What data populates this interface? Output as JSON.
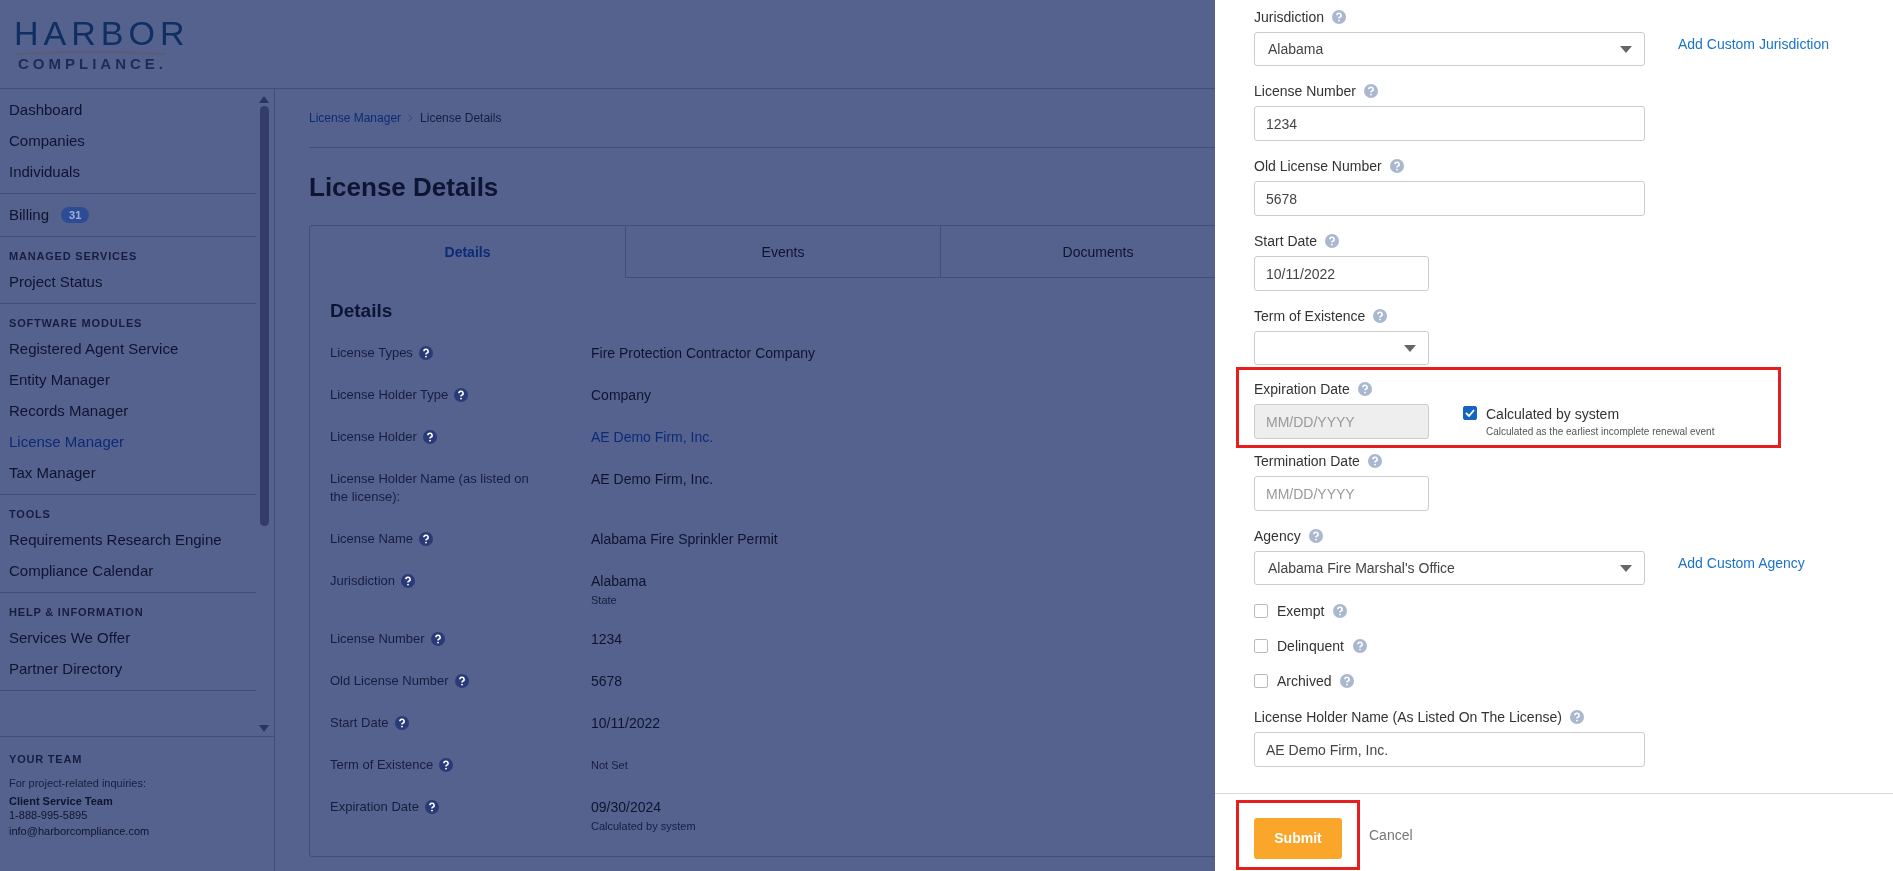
{
  "logo": {
    "wordmark": "HARBOR",
    "tagline": "COMPLIANCE."
  },
  "sidebar": {
    "groups": [
      {
        "items": [
          {
            "label": "Dashboard",
            "selected": false
          },
          {
            "label": "Companies",
            "selected": false
          },
          {
            "label": "Individuals",
            "selected": false
          }
        ]
      },
      {
        "items": [
          {
            "label": "Billing",
            "selected": false,
            "badge": "31"
          }
        ]
      },
      {
        "heading": "MANAGED SERVICES",
        "items": [
          {
            "label": "Project Status",
            "selected": false
          }
        ]
      },
      {
        "heading": "SOFTWARE MODULES",
        "items": [
          {
            "label": "Registered Agent Service",
            "selected": false
          },
          {
            "label": "Entity Manager",
            "selected": false
          },
          {
            "label": "Records Manager",
            "selected": false
          },
          {
            "label": "License Manager",
            "selected": true
          },
          {
            "label": "Tax Manager",
            "selected": false
          }
        ]
      },
      {
        "heading": "TOOLS",
        "items": [
          {
            "label": "Requirements Research Engine",
            "selected": false
          },
          {
            "label": "Compliance Calendar",
            "selected": false
          }
        ]
      },
      {
        "heading": "HELP & INFORMATION",
        "items": [
          {
            "label": "Services We Offer",
            "selected": false
          },
          {
            "label": "Partner Directory",
            "selected": false
          }
        ]
      }
    ],
    "team": {
      "heading": "YOUR TEAM",
      "intro": "For project-related inquiries:",
      "contact_name": "Client Service Team",
      "phone": "1-888-995-5895",
      "email": "info@harborcompliance.com"
    }
  },
  "breadcrumb": [
    {
      "label": "License Manager",
      "kind": "link"
    },
    {
      "label": "License Details",
      "kind": "current"
    }
  ],
  "page_title": "License Details",
  "tabs": [
    {
      "label": "Details",
      "selected": true
    },
    {
      "label": "Events",
      "selected": false
    },
    {
      "label": "Documents",
      "selected": false
    }
  ],
  "details": {
    "heading": "Details",
    "rows": [
      {
        "label": "License Types",
        "help": true,
        "value": "Fire Protection Contractor Company",
        "kind": "text"
      },
      {
        "label": "License Holder Type",
        "help": true,
        "value": "Company",
        "kind": "text"
      },
      {
        "label": "License Holder",
        "help": true,
        "value": "AE Demo Firm, Inc.",
        "kind": "link"
      },
      {
        "label": "License Holder Name (as listed on the license):",
        "help": false,
        "value": "AE Demo Firm, Inc.",
        "kind": "text"
      },
      {
        "label": "License Name",
        "help": true,
        "value": "Alabama Fire Sprinkler Permit",
        "kind": "text"
      },
      {
        "label": "Jurisdiction",
        "help": true,
        "value": "Alabama",
        "kind": "text",
        "note": "State"
      },
      {
        "label": "License Number",
        "help": true,
        "value": "1234",
        "kind": "text"
      },
      {
        "label": "Old License Number",
        "help": true,
        "value": "5678",
        "kind": "text"
      },
      {
        "label": "Start Date",
        "help": true,
        "value": "10/11/2022",
        "kind": "text"
      },
      {
        "label": "Term of Existence",
        "help": true,
        "value": "Not Set",
        "kind": "muted"
      },
      {
        "label": "Expiration Date",
        "help": true,
        "value": "09/30/2024",
        "kind": "text",
        "note": "Calculated by system"
      }
    ]
  },
  "drawer": {
    "fields": [
      {
        "kind": "select",
        "label": "Jurisdiction",
        "value": "Alabama",
        "link": "Add Custom Jurisdiction"
      },
      {
        "kind": "text",
        "label": "License Number",
        "value": "1234"
      },
      {
        "kind": "text",
        "label": "Old License Number",
        "value": "5678"
      },
      {
        "kind": "date",
        "label": "Start Date",
        "value": "10/11/2022"
      },
      {
        "kind": "short-select",
        "label": "Term of Existence"
      },
      {
        "kind": "calculated-date",
        "label": "Expiration Date",
        "placeholder": "MM/DD/YYYY",
        "disabled": true,
        "highlighted": true,
        "check": {
          "label": "Calculated by system",
          "checked": true,
          "note": "Calculated as the earliest incomplete renewal event"
        }
      },
      {
        "kind": "date",
        "label": "Termination Date",
        "placeholder": "MM/DD/YYYY"
      },
      {
        "kind": "select",
        "label": "Agency",
        "value": "Alabama Fire Marshal's Office",
        "link": "Add Custom Agency"
      },
      {
        "kind": "checkbox",
        "label": "Exempt",
        "checked": false
      },
      {
        "kind": "checkbox",
        "label": "Delinquent",
        "checked": false
      },
      {
        "kind": "checkbox",
        "label": "Archived",
        "checked": false
      },
      {
        "kind": "text",
        "label": "License Holder Name (As Listed On The License)",
        "value": "AE Demo Firm, Inc."
      }
    ],
    "submit": {
      "label": "Submit",
      "highlighted": true
    },
    "cancel": "Cancel"
  }
}
